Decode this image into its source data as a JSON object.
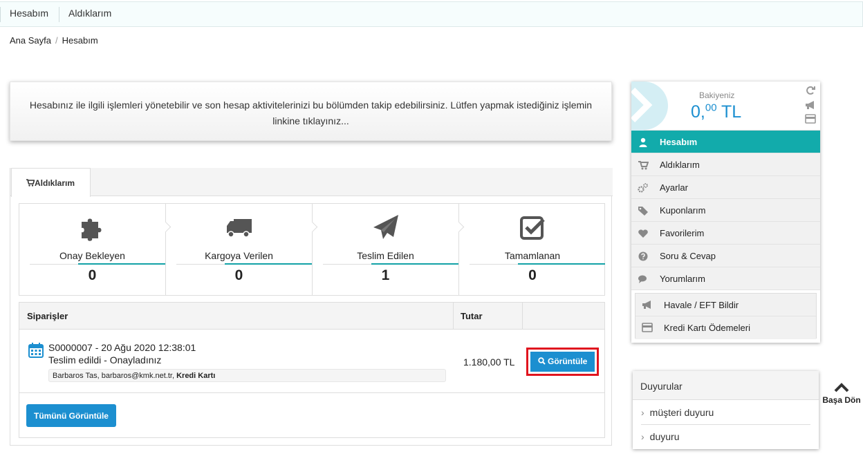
{
  "topbar": {
    "items": [
      "Hesabım",
      "Aldıklarım"
    ]
  },
  "breadcrumb": {
    "home": "Ana Sayfa",
    "separator": "/",
    "current": "Hesabım"
  },
  "intro": {
    "text_line1": "Hesabınız ile ilgili işlemleri yönetebilir ve son hesap aktivitelerinizi bu bölümden takip edebilirsiniz. Lütfen yapmak istediğiniz işlemin",
    "text_line2": "linkine tıklayınız..."
  },
  "tab": {
    "label": "Aldıklarım",
    "icon": "cart-icon"
  },
  "stats": [
    {
      "label": "Onay Bekleyen",
      "value": "0",
      "icon": "puzzle-icon"
    },
    {
      "label": "Kargoya Verilen",
      "value": "0",
      "icon": "truck-icon"
    },
    {
      "label": "Teslim Edilen",
      "value": "1",
      "icon": "paper-plane-icon"
    },
    {
      "label": "Tamamlanan",
      "value": "0",
      "icon": "check-square-icon"
    }
  ],
  "orders": {
    "col_orders": "Siparişler",
    "col_amount": "Tutar",
    "rows": [
      {
        "id_date": "S0000007 - 20 Ağu 2020 12:38:01",
        "status": "Teslim edildi - Onayladınız",
        "customer": "Barbaros Tas, barbaros@kmk.net.tr, ",
        "payment": "Kredi Kartı",
        "amount": "1.180,00 TL",
        "button": "Görüntüle"
      }
    ],
    "view_all": "Tümünü Görüntüle"
  },
  "balance": {
    "label": "Bakiyeniz",
    "int": "0,",
    "dec": "00",
    "cur": " TL",
    "icons": [
      "refresh-icon",
      "bullhorn-icon",
      "credit-card-icon"
    ]
  },
  "menu": [
    {
      "label": "Hesabım",
      "icon": "user-icon",
      "active": true
    },
    {
      "label": "Aldıklarım",
      "icon": "cart-icon"
    },
    {
      "label": "Ayarlar",
      "icon": "gears-icon"
    },
    {
      "label": "Kuponlarım",
      "icon": "tags-icon"
    },
    {
      "label": "Favorilerim",
      "icon": "heart-icon"
    },
    {
      "label": "Soru & Cevap",
      "icon": "question-icon"
    },
    {
      "label": "Yorumlarım",
      "icon": "comments-icon"
    }
  ],
  "submenu": [
    {
      "label": "Havale / EFT Bildir",
      "icon": "bullhorn-icon"
    },
    {
      "label": "Kredi Kartı Ödemeleri",
      "icon": "credit-card-icon"
    }
  ],
  "announcements": {
    "title": "Duyurular",
    "items": [
      "müşteri duyuru",
      "duyuru"
    ],
    "chevron": "›"
  },
  "back_to_top": "Başa Dön",
  "colors": {
    "teal": "#12abab",
    "blue": "#1c8fd0",
    "highlight": "#e0141e"
  }
}
